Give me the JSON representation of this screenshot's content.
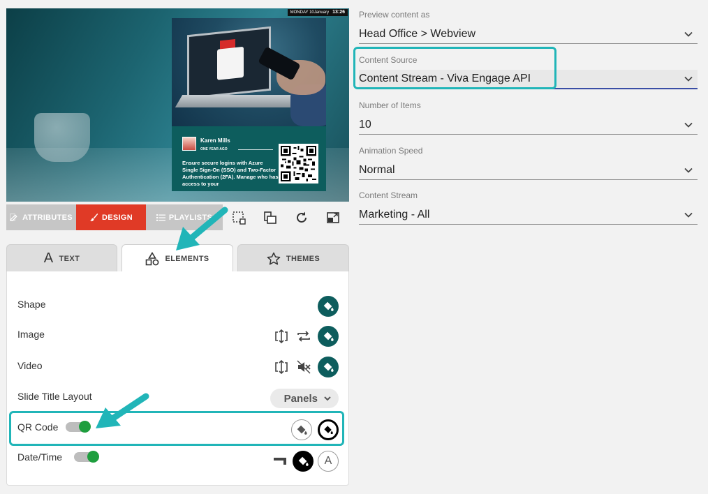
{
  "colors": {
    "accent_teal": "#0d5d5d",
    "design_red": "#e03a26",
    "highlight": "#21b5b8",
    "toggle_on": "#1e9e3e"
  },
  "preview": {
    "clock_date": "MONDAY 10January",
    "clock_time": "13:26",
    "author": "Karen Mills",
    "time_ago": "ONE YEAR AGO",
    "post_text": "Ensure secure logins with Azure Single Sign-On (SSO) and Two-Factor Authentication (2FA). Manage who has access to your"
  },
  "toolbar": {
    "attributes_label": "ATTRIBUTES",
    "design_label": "DESIGN",
    "playlists_label": "PLAYLISTS",
    "icons": [
      "select-area-icon",
      "layers-icon",
      "refresh-icon",
      "resize-icon"
    ]
  },
  "tabs": {
    "text_label": "TEXT",
    "elements_label": "ELEMENTS",
    "themes_label": "THEMES"
  },
  "elements": {
    "shape_label": "Shape",
    "image_label": "Image",
    "video_label": "Video",
    "slide_title_layout_label": "Slide Title Layout",
    "slide_title_layout_value": "Panels",
    "qr_code_label": "QR Code",
    "qr_code_on": true,
    "datetime_label": "Date/Time",
    "datetime_on": true,
    "aa_glyph": "A"
  },
  "settings": {
    "preview_as_label": "Preview content as",
    "preview_as_value": "Head Office > Webview",
    "content_source_label": "Content Source",
    "content_source_value": "Content Stream - Viva Engage API",
    "num_items_label": "Number of Items",
    "num_items_value": "10",
    "animation_speed_label": "Animation Speed",
    "animation_speed_value": "Normal",
    "content_stream_label": "Content Stream",
    "content_stream_value": "Marketing - All"
  }
}
